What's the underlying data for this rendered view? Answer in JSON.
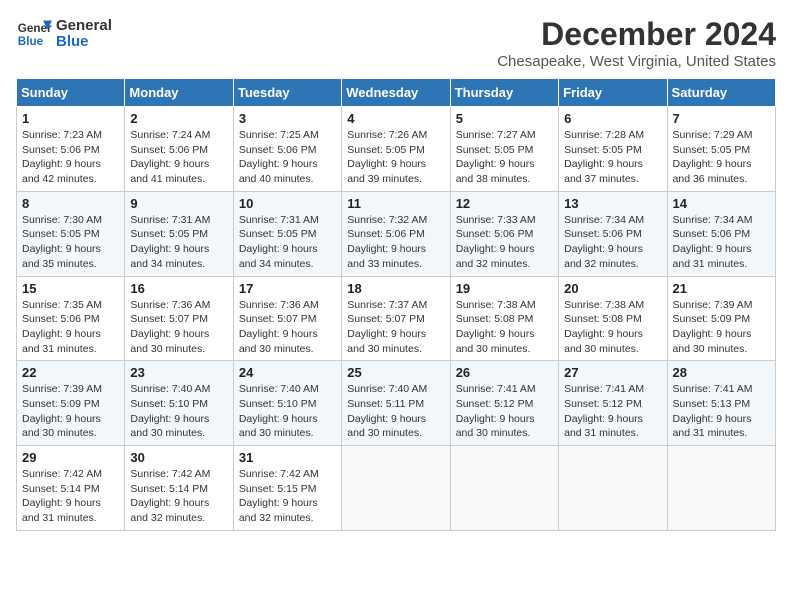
{
  "header": {
    "logo_line1": "General",
    "logo_line2": "Blue",
    "title": "December 2024",
    "subtitle": "Chesapeake, West Virginia, United States"
  },
  "columns": [
    "Sunday",
    "Monday",
    "Tuesday",
    "Wednesday",
    "Thursday",
    "Friday",
    "Saturday"
  ],
  "weeks": [
    [
      {
        "day": "1",
        "sunrise": "7:23 AM",
        "sunset": "5:06 PM",
        "daylight": "9 hours and 42 minutes."
      },
      {
        "day": "2",
        "sunrise": "7:24 AM",
        "sunset": "5:06 PM",
        "daylight": "9 hours and 41 minutes."
      },
      {
        "day": "3",
        "sunrise": "7:25 AM",
        "sunset": "5:06 PM",
        "daylight": "9 hours and 40 minutes."
      },
      {
        "day": "4",
        "sunrise": "7:26 AM",
        "sunset": "5:05 PM",
        "daylight": "9 hours and 39 minutes."
      },
      {
        "day": "5",
        "sunrise": "7:27 AM",
        "sunset": "5:05 PM",
        "daylight": "9 hours and 38 minutes."
      },
      {
        "day": "6",
        "sunrise": "7:28 AM",
        "sunset": "5:05 PM",
        "daylight": "9 hours and 37 minutes."
      },
      {
        "day": "7",
        "sunrise": "7:29 AM",
        "sunset": "5:05 PM",
        "daylight": "9 hours and 36 minutes."
      }
    ],
    [
      {
        "day": "8",
        "sunrise": "7:30 AM",
        "sunset": "5:05 PM",
        "daylight": "9 hours and 35 minutes."
      },
      {
        "day": "9",
        "sunrise": "7:31 AM",
        "sunset": "5:05 PM",
        "daylight": "9 hours and 34 minutes."
      },
      {
        "day": "10",
        "sunrise": "7:31 AM",
        "sunset": "5:05 PM",
        "daylight": "9 hours and 34 minutes."
      },
      {
        "day": "11",
        "sunrise": "7:32 AM",
        "sunset": "5:06 PM",
        "daylight": "9 hours and 33 minutes."
      },
      {
        "day": "12",
        "sunrise": "7:33 AM",
        "sunset": "5:06 PM",
        "daylight": "9 hours and 32 minutes."
      },
      {
        "day": "13",
        "sunrise": "7:34 AM",
        "sunset": "5:06 PM",
        "daylight": "9 hours and 32 minutes."
      },
      {
        "day": "14",
        "sunrise": "7:34 AM",
        "sunset": "5:06 PM",
        "daylight": "9 hours and 31 minutes."
      }
    ],
    [
      {
        "day": "15",
        "sunrise": "7:35 AM",
        "sunset": "5:06 PM",
        "daylight": "9 hours and 31 minutes."
      },
      {
        "day": "16",
        "sunrise": "7:36 AM",
        "sunset": "5:07 PM",
        "daylight": "9 hours and 30 minutes."
      },
      {
        "day": "17",
        "sunrise": "7:36 AM",
        "sunset": "5:07 PM",
        "daylight": "9 hours and 30 minutes."
      },
      {
        "day": "18",
        "sunrise": "7:37 AM",
        "sunset": "5:07 PM",
        "daylight": "9 hours and 30 minutes."
      },
      {
        "day": "19",
        "sunrise": "7:38 AM",
        "sunset": "5:08 PM",
        "daylight": "9 hours and 30 minutes."
      },
      {
        "day": "20",
        "sunrise": "7:38 AM",
        "sunset": "5:08 PM",
        "daylight": "9 hours and 30 minutes."
      },
      {
        "day": "21",
        "sunrise": "7:39 AM",
        "sunset": "5:09 PM",
        "daylight": "9 hours and 30 minutes."
      }
    ],
    [
      {
        "day": "22",
        "sunrise": "7:39 AM",
        "sunset": "5:09 PM",
        "daylight": "9 hours and 30 minutes."
      },
      {
        "day": "23",
        "sunrise": "7:40 AM",
        "sunset": "5:10 PM",
        "daylight": "9 hours and 30 minutes."
      },
      {
        "day": "24",
        "sunrise": "7:40 AM",
        "sunset": "5:10 PM",
        "daylight": "9 hours and 30 minutes."
      },
      {
        "day": "25",
        "sunrise": "7:40 AM",
        "sunset": "5:11 PM",
        "daylight": "9 hours and 30 minutes."
      },
      {
        "day": "26",
        "sunrise": "7:41 AM",
        "sunset": "5:12 PM",
        "daylight": "9 hours and 30 minutes."
      },
      {
        "day": "27",
        "sunrise": "7:41 AM",
        "sunset": "5:12 PM",
        "daylight": "9 hours and 31 minutes."
      },
      {
        "day": "28",
        "sunrise": "7:41 AM",
        "sunset": "5:13 PM",
        "daylight": "9 hours and 31 minutes."
      }
    ],
    [
      {
        "day": "29",
        "sunrise": "7:42 AM",
        "sunset": "5:14 PM",
        "daylight": "9 hours and 31 minutes."
      },
      {
        "day": "30",
        "sunrise": "7:42 AM",
        "sunset": "5:14 PM",
        "daylight": "9 hours and 32 minutes."
      },
      {
        "day": "31",
        "sunrise": "7:42 AM",
        "sunset": "5:15 PM",
        "daylight": "9 hours and 32 minutes."
      },
      null,
      null,
      null,
      null
    ]
  ],
  "labels": {
    "sunrise": "Sunrise:",
    "sunset": "Sunset:",
    "daylight": "Daylight:"
  }
}
